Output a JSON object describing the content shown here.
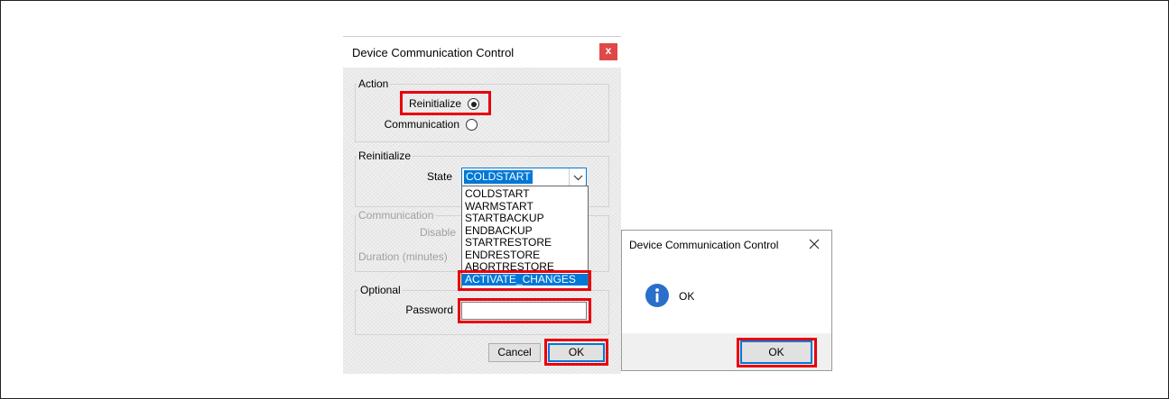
{
  "dialog": {
    "title": "Device Communication Control",
    "close_label": "x",
    "action_group": {
      "label": "Action",
      "options": [
        {
          "label": "Reinitialize",
          "checked": true
        },
        {
          "label": "Communication",
          "checked": false
        }
      ]
    },
    "reinitialize_group": {
      "label": "Reinitialize",
      "state_label": "State",
      "state_value": "COLDSTART",
      "dropdown_open": true,
      "state_options": [
        "COLDSTART",
        "WARMSTART",
        "STARTBACKUP",
        "ENDBACKUP",
        "STARTRESTORE",
        "ENDRESTORE",
        "ABORTRESTORE",
        "ACTIVATE_CHANGES"
      ],
      "highlighted_index": 7
    },
    "communication_group": {
      "label": "Communication",
      "disable_label": "Disable",
      "duration_label": "Duration (minutes)",
      "enabled": false
    },
    "optional_group": {
      "label": "Optional",
      "password_label": "Password",
      "password_value": ""
    },
    "buttons": {
      "cancel_label": "Cancel",
      "ok_label": "OK"
    }
  },
  "message_box": {
    "title": "Device Communication Control",
    "close_icon": "close-icon",
    "icon": "info-icon",
    "message": "OK",
    "ok_label": "OK"
  },
  "colors": {
    "selection_blue": "#0078d7",
    "annotation_red": "#e8000b",
    "close_button_red": "#e04848",
    "info_blue": "#2a6fc9"
  }
}
